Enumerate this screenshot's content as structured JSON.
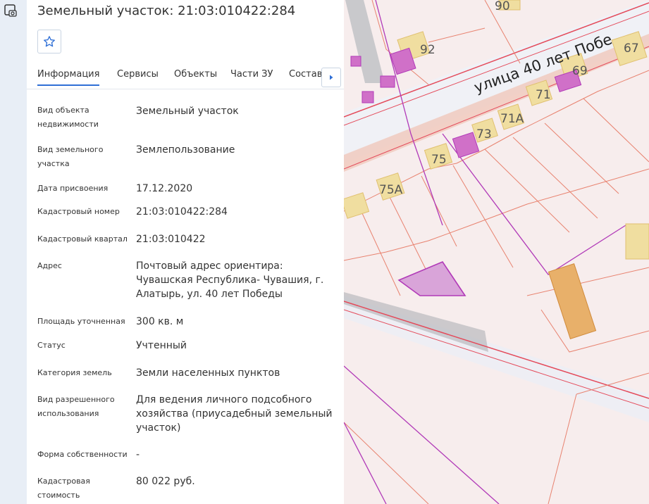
{
  "header": {
    "title": "Земельный участок: 21:03:010422:284"
  },
  "tabs": [
    "Информация",
    "Сервисы",
    "Объекты",
    "Части ЗУ",
    "Состав"
  ],
  "info_rows": [
    {
      "label": "Вид объекта недвижимости",
      "value": "Земельный участок"
    },
    {
      "label": "Вид земельного участка",
      "value": "Землепользование"
    },
    {
      "label": "Дата присвоения",
      "value": "17.12.2020"
    },
    {
      "label": "Кадастровый номер",
      "value": "21:03:010422:284"
    },
    {
      "label": "Кадастровый квартал",
      "value": "21:03:010422"
    },
    {
      "label": "Адрес",
      "value": "Почтовый адрес ориентира: Чувашская Республика- Чувашия, г. Алатырь, ул. 40 лет Победы"
    },
    {
      "label": "Площадь уточненная",
      "value": "300 кв. м"
    },
    {
      "label": "Статус",
      "value": "Учтенный"
    },
    {
      "label": "Категория земель",
      "value": "Земли населенных пунктов"
    },
    {
      "label": "Вид разрешенного использования",
      "value": "Для ведения личного подсобного хозяйства (приусадебный земельный участок)"
    },
    {
      "label": "Форма собственности",
      "value": "-"
    },
    {
      "label": "Кадастровая стоимость",
      "value": "80 022 руб."
    }
  ],
  "map": {
    "street_label": "улица 40 лет Побе",
    "house_numbers": [
      "90",
      "92",
      "67",
      "69",
      "71",
      "71А",
      "73",
      "75",
      "75А"
    ]
  },
  "colors": {
    "accent": "#2f6fd6",
    "parcel_line": "#e8826f",
    "highlight": "#b13ab8",
    "building": "#f0dea0"
  },
  "icons": {
    "toolbar": "camera-icon",
    "favorite": "star-icon",
    "tabs_next": "chevron-right-icon"
  }
}
